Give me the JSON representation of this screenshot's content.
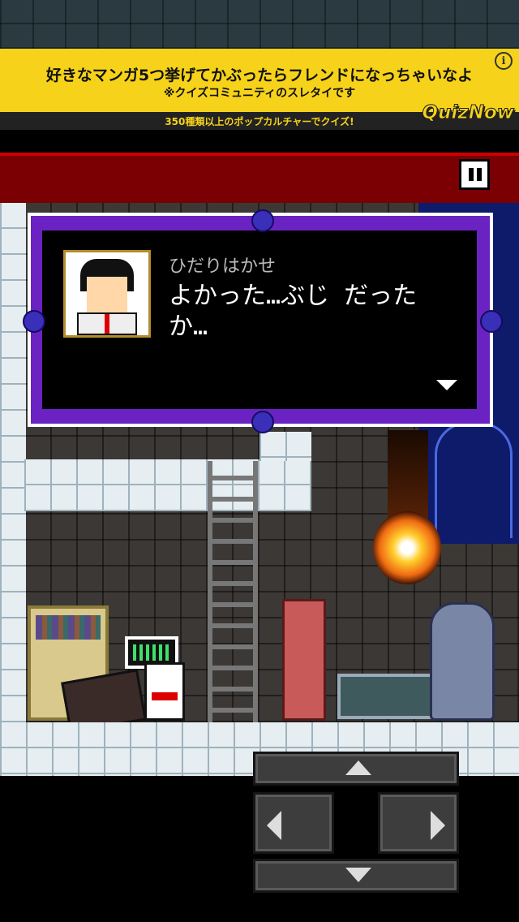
{
  "ad": {
    "headline": "好きなマンガ5つ挙げてかぶったらフレンドになっちゃいなよ",
    "subline": "※クイズコミュニティのスレタイです",
    "tagline": "350種類以上のポップカルチャーでクイズ!",
    "brand": "QuizNow",
    "info_icon": "i"
  },
  "dialog": {
    "speaker": "ひだりはかせ",
    "message_line1": "よかった…ぶじ だった",
    "message_line2": "か…"
  },
  "colors": {
    "ad_bg": "#f6d21a",
    "header_bg": "#7a0004",
    "dialog_frame": "#6a23c2",
    "fireball": "#ffcf2e"
  },
  "icons": {
    "pause": "pause-icon",
    "next": "triangle-down-icon",
    "dpad_up": "arrow-up-icon",
    "dpad_down": "arrow-down-icon",
    "dpad_left": "arrow-left-icon",
    "dpad_right": "arrow-right-icon"
  }
}
